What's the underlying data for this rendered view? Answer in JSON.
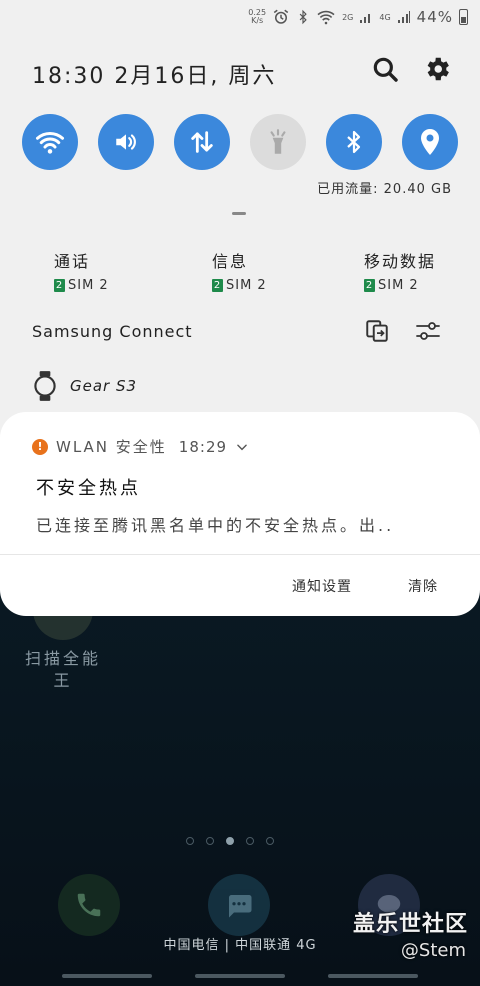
{
  "status_bar": {
    "net_speed_value": "0.25",
    "net_speed_unit": "K/s",
    "signal_label_1": "2G",
    "signal_label_2": "4G",
    "battery": "44%",
    "icons": [
      "alarm-icon",
      "bluetooth-icon",
      "wifi-icon",
      "signal-icon",
      "battery-icon"
    ]
  },
  "header": {
    "datetime": "18:30 2月16日, 周六",
    "search_icon": "search-icon",
    "settings_icon": "gear-icon"
  },
  "quick_tiles": [
    {
      "name": "wifi",
      "icon": "wifi-icon",
      "state": "on"
    },
    {
      "name": "sound",
      "icon": "speaker-icon",
      "state": "on"
    },
    {
      "name": "mobile-data",
      "icon": "data-arrows-icon",
      "state": "on"
    },
    {
      "name": "flashlight",
      "icon": "flashlight-icon",
      "state": "off"
    },
    {
      "name": "bluetooth",
      "icon": "bluetooth-icon",
      "state": "on"
    },
    {
      "name": "location",
      "icon": "location-pin-icon",
      "state": "on"
    }
  ],
  "data_usage": "已用流量: 20.40 GB",
  "sim_settings": [
    {
      "title": "通话",
      "sim_badge": "2",
      "sim_label": "SIM 2"
    },
    {
      "title": "信息",
      "sim_badge": "2",
      "sim_label": "SIM 2"
    },
    {
      "title": "移动数据",
      "sim_badge": "2",
      "sim_label": "SIM 2"
    }
  ],
  "samsung_connect": {
    "label": "Samsung Connect",
    "device_name": "Gear S3"
  },
  "notification": {
    "app_icon_symbol": "!",
    "app_name": "WLAN 安全性",
    "time": "18:29",
    "title": "不安全热点",
    "body": "已连接至腾讯黑名单中的不安全热点。出..",
    "actions": {
      "settings": "通知设置",
      "clear": "清除"
    }
  },
  "home_screen": {
    "app_label": "扫描全能王",
    "carrier_text": "中国电信 | 中国联通 4G"
  },
  "watermark": {
    "title": "盖乐世社区",
    "user": "@Stem"
  },
  "colors": {
    "tile_on": "#3b88dc",
    "tile_off": "#dcdcdc",
    "panel_bg": "#f0f0f0",
    "sim_badge": "#1e8a4a",
    "warning": "#e8721c"
  }
}
